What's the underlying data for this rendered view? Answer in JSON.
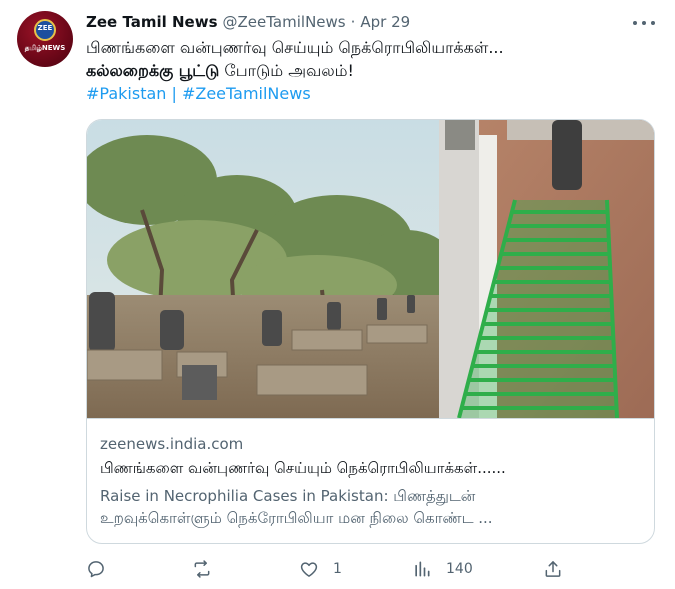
{
  "tweet": {
    "author_name": "Zee Tamil News",
    "handle": "@ZeeTamilNews",
    "separator": "·",
    "date": "Apr 29",
    "avatar": {
      "logo_text": "ZEE",
      "sub_text": "தமிழ்NEWS"
    },
    "text_line1": "பிணங்களை வன்புணர்வு செய்யும் நெக்ரொபிலியாக்கள்...",
    "text_line2_bold": "கல்லறைக்கு பூட்டு",
    "text_line2_rest": " போடும் அவலம்!",
    "hashtag1": "#Pakistan",
    "hashtag_sep": " | ",
    "hashtag2": "#ZeeTamilNews"
  },
  "card": {
    "domain": "zeenews.india.com",
    "title": "பிணங்களை வன்புணர்வு செய்யும் நெக்ரொபிலியாக்கள்......",
    "description_line1": "Raise in Necrophilia Cases in Pakistan: பிணத்துடன்",
    "description_line2": "உறவுக்கொள்ளும் நெக்ரோபிலியா மன நிலை கொண்ட ..."
  },
  "actions": {
    "reply": {
      "icon": "reply-icon",
      "count": ""
    },
    "retweet": {
      "icon": "retweet-icon",
      "count": ""
    },
    "like": {
      "icon": "heart-icon",
      "count": "1"
    },
    "views": {
      "icon": "views-icon",
      "count": "140"
    },
    "share": {
      "icon": "share-icon"
    }
  },
  "colors": {
    "text": "#0f1419",
    "secondary": "#536471",
    "link": "#1d9bf0",
    "border": "#cfd9de",
    "cage_green": "#2fae4a"
  }
}
